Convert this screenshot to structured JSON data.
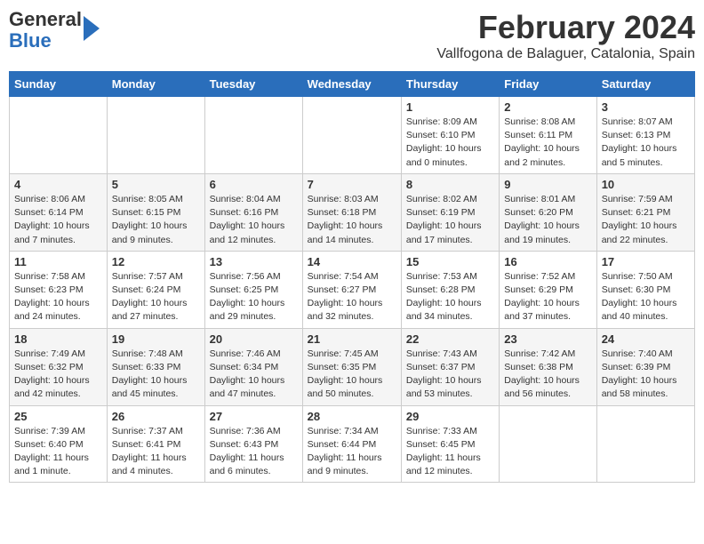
{
  "header": {
    "logo_general": "General",
    "logo_blue": "Blue",
    "month_title": "February 2024",
    "subtitle": "Vallfogona de Balaguer, Catalonia, Spain"
  },
  "weekdays": [
    "Sunday",
    "Monday",
    "Tuesday",
    "Wednesday",
    "Thursday",
    "Friday",
    "Saturday"
  ],
  "weeks": [
    [
      {
        "day": "",
        "info": ""
      },
      {
        "day": "",
        "info": ""
      },
      {
        "day": "",
        "info": ""
      },
      {
        "day": "",
        "info": ""
      },
      {
        "day": "1",
        "info": "Sunrise: 8:09 AM\nSunset: 6:10 PM\nDaylight: 10 hours\nand 0 minutes."
      },
      {
        "day": "2",
        "info": "Sunrise: 8:08 AM\nSunset: 6:11 PM\nDaylight: 10 hours\nand 2 minutes."
      },
      {
        "day": "3",
        "info": "Sunrise: 8:07 AM\nSunset: 6:13 PM\nDaylight: 10 hours\nand 5 minutes."
      }
    ],
    [
      {
        "day": "4",
        "info": "Sunrise: 8:06 AM\nSunset: 6:14 PM\nDaylight: 10 hours\nand 7 minutes."
      },
      {
        "day": "5",
        "info": "Sunrise: 8:05 AM\nSunset: 6:15 PM\nDaylight: 10 hours\nand 9 minutes."
      },
      {
        "day": "6",
        "info": "Sunrise: 8:04 AM\nSunset: 6:16 PM\nDaylight: 10 hours\nand 12 minutes."
      },
      {
        "day": "7",
        "info": "Sunrise: 8:03 AM\nSunset: 6:18 PM\nDaylight: 10 hours\nand 14 minutes."
      },
      {
        "day": "8",
        "info": "Sunrise: 8:02 AM\nSunset: 6:19 PM\nDaylight: 10 hours\nand 17 minutes."
      },
      {
        "day": "9",
        "info": "Sunrise: 8:01 AM\nSunset: 6:20 PM\nDaylight: 10 hours\nand 19 minutes."
      },
      {
        "day": "10",
        "info": "Sunrise: 7:59 AM\nSunset: 6:21 PM\nDaylight: 10 hours\nand 22 minutes."
      }
    ],
    [
      {
        "day": "11",
        "info": "Sunrise: 7:58 AM\nSunset: 6:23 PM\nDaylight: 10 hours\nand 24 minutes."
      },
      {
        "day": "12",
        "info": "Sunrise: 7:57 AM\nSunset: 6:24 PM\nDaylight: 10 hours\nand 27 minutes."
      },
      {
        "day": "13",
        "info": "Sunrise: 7:56 AM\nSunset: 6:25 PM\nDaylight: 10 hours\nand 29 minutes."
      },
      {
        "day": "14",
        "info": "Sunrise: 7:54 AM\nSunset: 6:27 PM\nDaylight: 10 hours\nand 32 minutes."
      },
      {
        "day": "15",
        "info": "Sunrise: 7:53 AM\nSunset: 6:28 PM\nDaylight: 10 hours\nand 34 minutes."
      },
      {
        "day": "16",
        "info": "Sunrise: 7:52 AM\nSunset: 6:29 PM\nDaylight: 10 hours\nand 37 minutes."
      },
      {
        "day": "17",
        "info": "Sunrise: 7:50 AM\nSunset: 6:30 PM\nDaylight: 10 hours\nand 40 minutes."
      }
    ],
    [
      {
        "day": "18",
        "info": "Sunrise: 7:49 AM\nSunset: 6:32 PM\nDaylight: 10 hours\nand 42 minutes."
      },
      {
        "day": "19",
        "info": "Sunrise: 7:48 AM\nSunset: 6:33 PM\nDaylight: 10 hours\nand 45 minutes."
      },
      {
        "day": "20",
        "info": "Sunrise: 7:46 AM\nSunset: 6:34 PM\nDaylight: 10 hours\nand 47 minutes."
      },
      {
        "day": "21",
        "info": "Sunrise: 7:45 AM\nSunset: 6:35 PM\nDaylight: 10 hours\nand 50 minutes."
      },
      {
        "day": "22",
        "info": "Sunrise: 7:43 AM\nSunset: 6:37 PM\nDaylight: 10 hours\nand 53 minutes."
      },
      {
        "day": "23",
        "info": "Sunrise: 7:42 AM\nSunset: 6:38 PM\nDaylight: 10 hours\nand 56 minutes."
      },
      {
        "day": "24",
        "info": "Sunrise: 7:40 AM\nSunset: 6:39 PM\nDaylight: 10 hours\nand 58 minutes."
      }
    ],
    [
      {
        "day": "25",
        "info": "Sunrise: 7:39 AM\nSunset: 6:40 PM\nDaylight: 11 hours\nand 1 minute."
      },
      {
        "day": "26",
        "info": "Sunrise: 7:37 AM\nSunset: 6:41 PM\nDaylight: 11 hours\nand 4 minutes."
      },
      {
        "day": "27",
        "info": "Sunrise: 7:36 AM\nSunset: 6:43 PM\nDaylight: 11 hours\nand 6 minutes."
      },
      {
        "day": "28",
        "info": "Sunrise: 7:34 AM\nSunset: 6:44 PM\nDaylight: 11 hours\nand 9 minutes."
      },
      {
        "day": "29",
        "info": "Sunrise: 7:33 AM\nSunset: 6:45 PM\nDaylight: 11 hours\nand 12 minutes."
      },
      {
        "day": "",
        "info": ""
      },
      {
        "day": "",
        "info": ""
      }
    ]
  ]
}
